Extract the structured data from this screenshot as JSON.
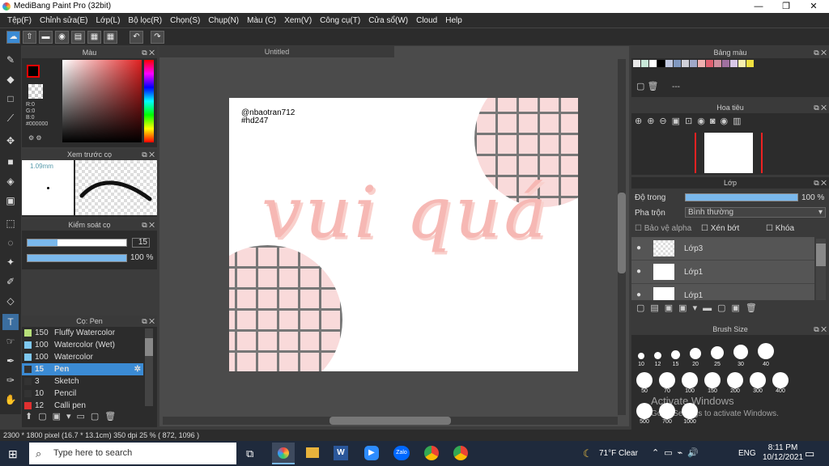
{
  "app": {
    "title": "MediBang Paint Pro (32bit)"
  },
  "window": {
    "minimize": "—",
    "maximize": "❐",
    "close": "✕"
  },
  "menu": [
    "Tệp(F)",
    "Chỉnh sửa(E)",
    "Lớp(L)",
    "Bộ lọc(R)",
    "Chọn(S)",
    "Chụp(N)",
    "Màu (C)",
    "Xem(V)",
    "Công cụ(T)",
    "Cửa sổ(W)",
    "Cloud",
    "Help"
  ],
  "color_panel": {
    "title": "Màu",
    "r": "R:0",
    "g": "G:0",
    "b": "B:0",
    "hex": "#000000",
    "primary_color": "#000000"
  },
  "brush_preview": {
    "title": "Xem trước cọ",
    "size": "1.09mm"
  },
  "brush_control": {
    "title": "Kiểm soát cọ",
    "size_value": "15",
    "opacity_value": "100 %"
  },
  "brush_list": {
    "title": "Cọ: Pen",
    "items": [
      {
        "size": "150",
        "name": "Fluffy Watercolor",
        "color": "#b7e07a",
        "selected": false
      },
      {
        "size": "100",
        "name": "Watercolor (Wet)",
        "color": "#7ec8f0",
        "selected": false
      },
      {
        "size": "100",
        "name": "Watercolor",
        "color": "#7ec8f0",
        "selected": false
      },
      {
        "size": "15",
        "name": "Pen",
        "color": "#333333",
        "selected": true
      },
      {
        "size": "3",
        "name": "Sketch",
        "color": "#333333",
        "selected": false
      },
      {
        "size": "10",
        "name": "Pencil",
        "color": "#333333",
        "selected": false
      },
      {
        "size": "12",
        "name": "Calli pen",
        "color": "#e03030",
        "selected": false
      }
    ]
  },
  "canvas": {
    "tab": "Untitled",
    "watermark_line1": "@nbaotran712",
    "watermark_line2": "#hd247",
    "lettering": "vui quá"
  },
  "palette": {
    "title": "Bảng màu",
    "swatches": [
      "#e8e8e8",
      "#c8e8d8",
      "#ffffff",
      "#000000",
      "#c0c8e0",
      "#8098c0",
      "#d0d0d8",
      "#a0a8c8",
      "#f0b0b0",
      "#e06070",
      "#d090a0",
      "#a070a0",
      "#d8c8e8",
      "#f8f0b0",
      "#f0e040"
    ],
    "label": "---"
  },
  "navigator": {
    "title": "Hoa tiêu"
  },
  "layers": {
    "title": "Lớp",
    "opacity_label": "Độ trong",
    "opacity_value": "100 %",
    "opacity_fraction": 1.0,
    "blend_label": "Pha trộn",
    "blend_value": "Bình thường",
    "protect_alpha": "Bảo vệ alpha",
    "clipping": "Xén bớt",
    "lock": "Khóa",
    "items": [
      "Lớp3",
      "Lớp1",
      "Lớp1"
    ]
  },
  "brush_size": {
    "title": "Brush Size",
    "rows": [
      [
        "10",
        "12",
        "15",
        "20",
        "25",
        "30",
        "40"
      ],
      [
        "50",
        "70",
        "100",
        "150",
        "200",
        "300",
        "400"
      ],
      [
        "500",
        "700",
        "1000"
      ]
    ]
  },
  "status": {
    "text": "2300 * 1800 pixel   (16.7 * 13.1cm)   350 dpi   25 %   ( 872, 1096 )"
  },
  "taskbar": {
    "search_placeholder": "Type here to search",
    "weather": "71°F  Clear",
    "lang": "ENG",
    "time": "8:11 PM",
    "date": "10/12/2021"
  },
  "activation": {
    "line1": "Activate Windows",
    "line2": "Go to Settings to activate Windows."
  }
}
